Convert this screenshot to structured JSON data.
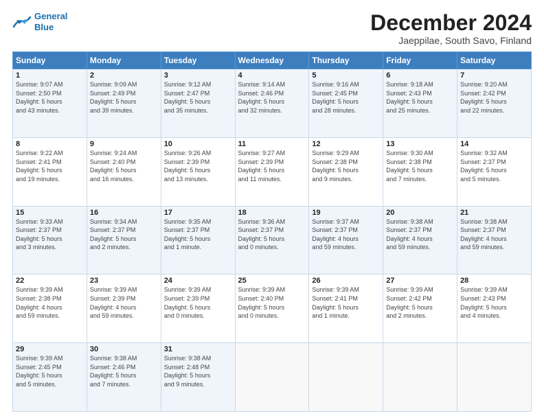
{
  "logo": {
    "line1": "General",
    "line2": "Blue"
  },
  "title": "December 2024",
  "subtitle": "Jaeppilae, South Savo, Finland",
  "days_header": [
    "Sunday",
    "Monday",
    "Tuesday",
    "Wednesday",
    "Thursday",
    "Friday",
    "Saturday"
  ],
  "weeks": [
    [
      {
        "day": "1",
        "info": "Sunrise: 9:07 AM\nSunset: 2:50 PM\nDaylight: 5 hours\nand 43 minutes."
      },
      {
        "day": "2",
        "info": "Sunrise: 9:09 AM\nSunset: 2:49 PM\nDaylight: 5 hours\nand 39 minutes."
      },
      {
        "day": "3",
        "info": "Sunrise: 9:12 AM\nSunset: 2:47 PM\nDaylight: 5 hours\nand 35 minutes."
      },
      {
        "day": "4",
        "info": "Sunrise: 9:14 AM\nSunset: 2:46 PM\nDaylight: 5 hours\nand 32 minutes."
      },
      {
        "day": "5",
        "info": "Sunrise: 9:16 AM\nSunset: 2:45 PM\nDaylight: 5 hours\nand 28 minutes."
      },
      {
        "day": "6",
        "info": "Sunrise: 9:18 AM\nSunset: 2:43 PM\nDaylight: 5 hours\nand 25 minutes."
      },
      {
        "day": "7",
        "info": "Sunrise: 9:20 AM\nSunset: 2:42 PM\nDaylight: 5 hours\nand 22 minutes."
      }
    ],
    [
      {
        "day": "8",
        "info": "Sunrise: 9:22 AM\nSunset: 2:41 PM\nDaylight: 5 hours\nand 19 minutes."
      },
      {
        "day": "9",
        "info": "Sunrise: 9:24 AM\nSunset: 2:40 PM\nDaylight: 5 hours\nand 16 minutes."
      },
      {
        "day": "10",
        "info": "Sunrise: 9:26 AM\nSunset: 2:39 PM\nDaylight: 5 hours\nand 13 minutes."
      },
      {
        "day": "11",
        "info": "Sunrise: 9:27 AM\nSunset: 2:39 PM\nDaylight: 5 hours\nand 11 minutes."
      },
      {
        "day": "12",
        "info": "Sunrise: 9:29 AM\nSunset: 2:38 PM\nDaylight: 5 hours\nand 9 minutes."
      },
      {
        "day": "13",
        "info": "Sunrise: 9:30 AM\nSunset: 2:38 PM\nDaylight: 5 hours\nand 7 minutes."
      },
      {
        "day": "14",
        "info": "Sunrise: 9:32 AM\nSunset: 2:37 PM\nDaylight: 5 hours\nand 5 minutes."
      }
    ],
    [
      {
        "day": "15",
        "info": "Sunrise: 9:33 AM\nSunset: 2:37 PM\nDaylight: 5 hours\nand 3 minutes."
      },
      {
        "day": "16",
        "info": "Sunrise: 9:34 AM\nSunset: 2:37 PM\nDaylight: 5 hours\nand 2 minutes."
      },
      {
        "day": "17",
        "info": "Sunrise: 9:35 AM\nSunset: 2:37 PM\nDaylight: 5 hours\nand 1 minute."
      },
      {
        "day": "18",
        "info": "Sunrise: 9:36 AM\nSunset: 2:37 PM\nDaylight: 5 hours\nand 0 minutes."
      },
      {
        "day": "19",
        "info": "Sunrise: 9:37 AM\nSunset: 2:37 PM\nDaylight: 4 hours\nand 59 minutes."
      },
      {
        "day": "20",
        "info": "Sunrise: 9:38 AM\nSunset: 2:37 PM\nDaylight: 4 hours\nand 59 minutes."
      },
      {
        "day": "21",
        "info": "Sunrise: 9:38 AM\nSunset: 2:37 PM\nDaylight: 4 hours\nand 59 minutes."
      }
    ],
    [
      {
        "day": "22",
        "info": "Sunrise: 9:39 AM\nSunset: 2:38 PM\nDaylight: 4 hours\nand 59 minutes."
      },
      {
        "day": "23",
        "info": "Sunrise: 9:39 AM\nSunset: 2:39 PM\nDaylight: 4 hours\nand 59 minutes."
      },
      {
        "day": "24",
        "info": "Sunrise: 9:39 AM\nSunset: 2:39 PM\nDaylight: 5 hours\nand 0 minutes."
      },
      {
        "day": "25",
        "info": "Sunrise: 9:39 AM\nSunset: 2:40 PM\nDaylight: 5 hours\nand 0 minutes."
      },
      {
        "day": "26",
        "info": "Sunrise: 9:39 AM\nSunset: 2:41 PM\nDaylight: 5 hours\nand 1 minute."
      },
      {
        "day": "27",
        "info": "Sunrise: 9:39 AM\nSunset: 2:42 PM\nDaylight: 5 hours\nand 2 minutes."
      },
      {
        "day": "28",
        "info": "Sunrise: 9:39 AM\nSunset: 2:43 PM\nDaylight: 5 hours\nand 4 minutes."
      }
    ],
    [
      {
        "day": "29",
        "info": "Sunrise: 9:39 AM\nSunset: 2:45 PM\nDaylight: 5 hours\nand 5 minutes."
      },
      {
        "day": "30",
        "info": "Sunrise: 9:38 AM\nSunset: 2:46 PM\nDaylight: 5 hours\nand 7 minutes."
      },
      {
        "day": "31",
        "info": "Sunrise: 9:38 AM\nSunset: 2:48 PM\nDaylight: 5 hours\nand 9 minutes."
      },
      {
        "day": "",
        "info": ""
      },
      {
        "day": "",
        "info": ""
      },
      {
        "day": "",
        "info": ""
      },
      {
        "day": "",
        "info": ""
      }
    ]
  ]
}
